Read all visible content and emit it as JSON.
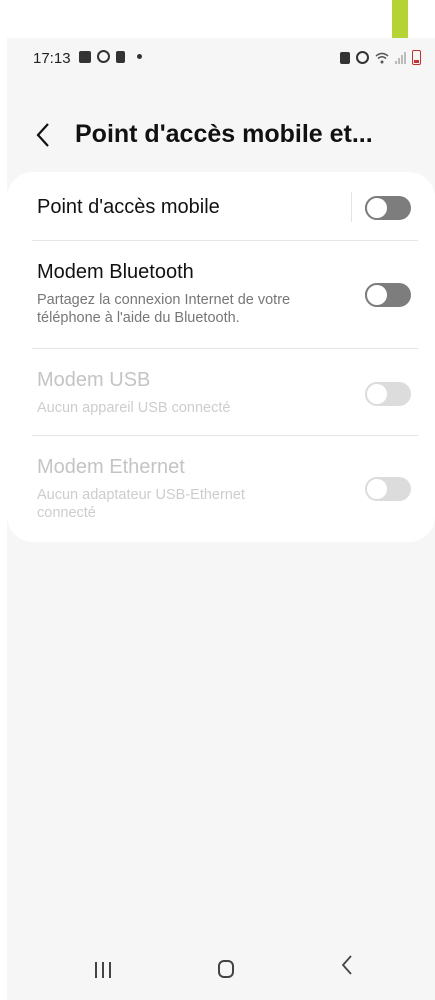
{
  "status_bar": {
    "time": "17:13",
    "left_icons": [
      "gallery-icon",
      "whatsapp-icon",
      "lock-badge-icon",
      "notification-dot-icon"
    ],
    "right_icons": [
      "hotspot-battery-icon",
      "alarm-icon",
      "wifi-icon",
      "signal-icon",
      "battery-icon"
    ]
  },
  "header": {
    "back_icon": "chevron-left-icon",
    "title": "Point d'accès mobile et..."
  },
  "settings": [
    {
      "title": "Point d'accès mobile",
      "subtitle": "",
      "enabled": true,
      "on": false
    },
    {
      "title": "Modem Bluetooth",
      "subtitle": "Partagez la connexion Internet de votre téléphone à l'aide du Bluetooth.",
      "enabled": true,
      "on": false
    },
    {
      "title": "Modem USB",
      "subtitle": "Aucun appareil USB connecté",
      "enabled": false,
      "on": false
    },
    {
      "title": "Modem Ethernet",
      "subtitle": "Aucun adaptateur USB-Ethernet connecté",
      "enabled": false,
      "on": false
    }
  ],
  "annotation": {
    "arrow_color": "#b5d334",
    "arrow_direction": "down"
  },
  "nav_bar": {
    "icons": [
      "recents-icon",
      "home-icon",
      "back-icon"
    ]
  }
}
